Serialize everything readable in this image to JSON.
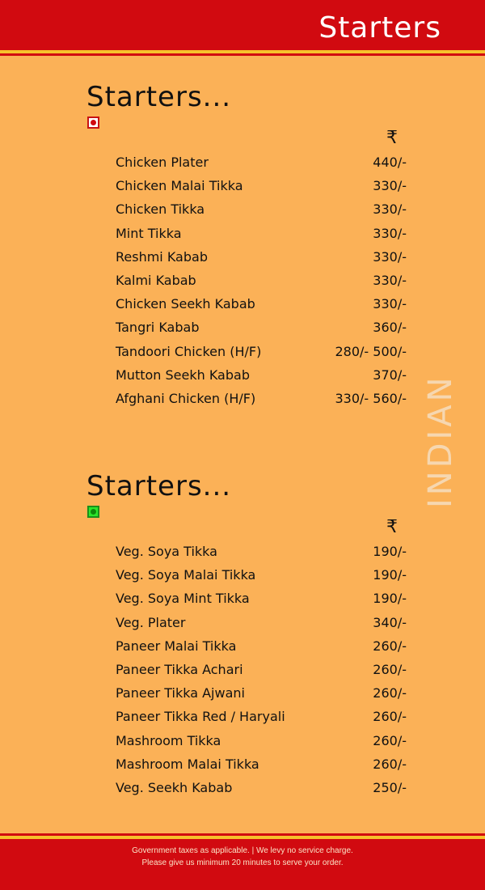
{
  "header": {
    "title": "Starters"
  },
  "side_label": "INDIAN",
  "sections": [
    {
      "title": "Starters...",
      "diet": "non-veg",
      "currency": "₹",
      "items": [
        {
          "name": "Chicken Plater",
          "price": "440/-"
        },
        {
          "name": "Chicken Malai Tikka",
          "price": "330/-"
        },
        {
          "name": "Chicken Tikka",
          "price": "330/-"
        },
        {
          "name": "Mint Tikka",
          "price": "330/-"
        },
        {
          "name": "Reshmi Kabab",
          "price": "330/-"
        },
        {
          "name": "Kalmi Kabab",
          "price": "330/-"
        },
        {
          "name": "Chicken Seekh Kabab",
          "price": "330/-"
        },
        {
          "name": "Tangri Kabab",
          "price": "360/-"
        },
        {
          "name": "Tandoori Chicken (H/F)",
          "price": "280/- 500/-"
        },
        {
          "name": "Mutton Seekh Kabab",
          "price": "370/-"
        },
        {
          "name": "Afghani Chicken (H/F)",
          "price": "330/- 560/-"
        }
      ]
    },
    {
      "title": "Starters...",
      "diet": "veg",
      "currency": "₹",
      "items": [
        {
          "name": "Veg. Soya Tikka",
          "price": "190/-"
        },
        {
          "name": "Veg. Soya Malai Tikka",
          "price": "190/-"
        },
        {
          "name": "Veg. Soya Mint Tikka",
          "price": "190/-"
        },
        {
          "name": "Veg. Plater",
          "price": "340/-"
        },
        {
          "name": "Paneer Malai Tikka",
          "price": "260/-"
        },
        {
          "name": "Paneer Tikka Achari",
          "price": "260/-"
        },
        {
          "name": "Paneer Tikka Ajwani",
          "price": "260/-"
        },
        {
          "name": "Paneer Tikka Red / Haryali",
          "price": "260/-"
        },
        {
          "name": "Mashroom Tikka",
          "price": "260/-"
        },
        {
          "name": "Mashroom Malai Tikka",
          "price": "260/-"
        },
        {
          "name": "Veg. Seekh Kabab",
          "price": "250/-"
        }
      ]
    }
  ],
  "footer": {
    "line1": "Government taxes as applicable. | We levy no service charge.",
    "line2": "Please give us minimum 20 minutes to serve your order."
  },
  "colors": {
    "background": "#FBB157",
    "brand_red": "#D10A10",
    "gold_rule": "#F7C12C",
    "non_veg_mark": "#D10A10",
    "veg_mark": "#2BE62B"
  }
}
